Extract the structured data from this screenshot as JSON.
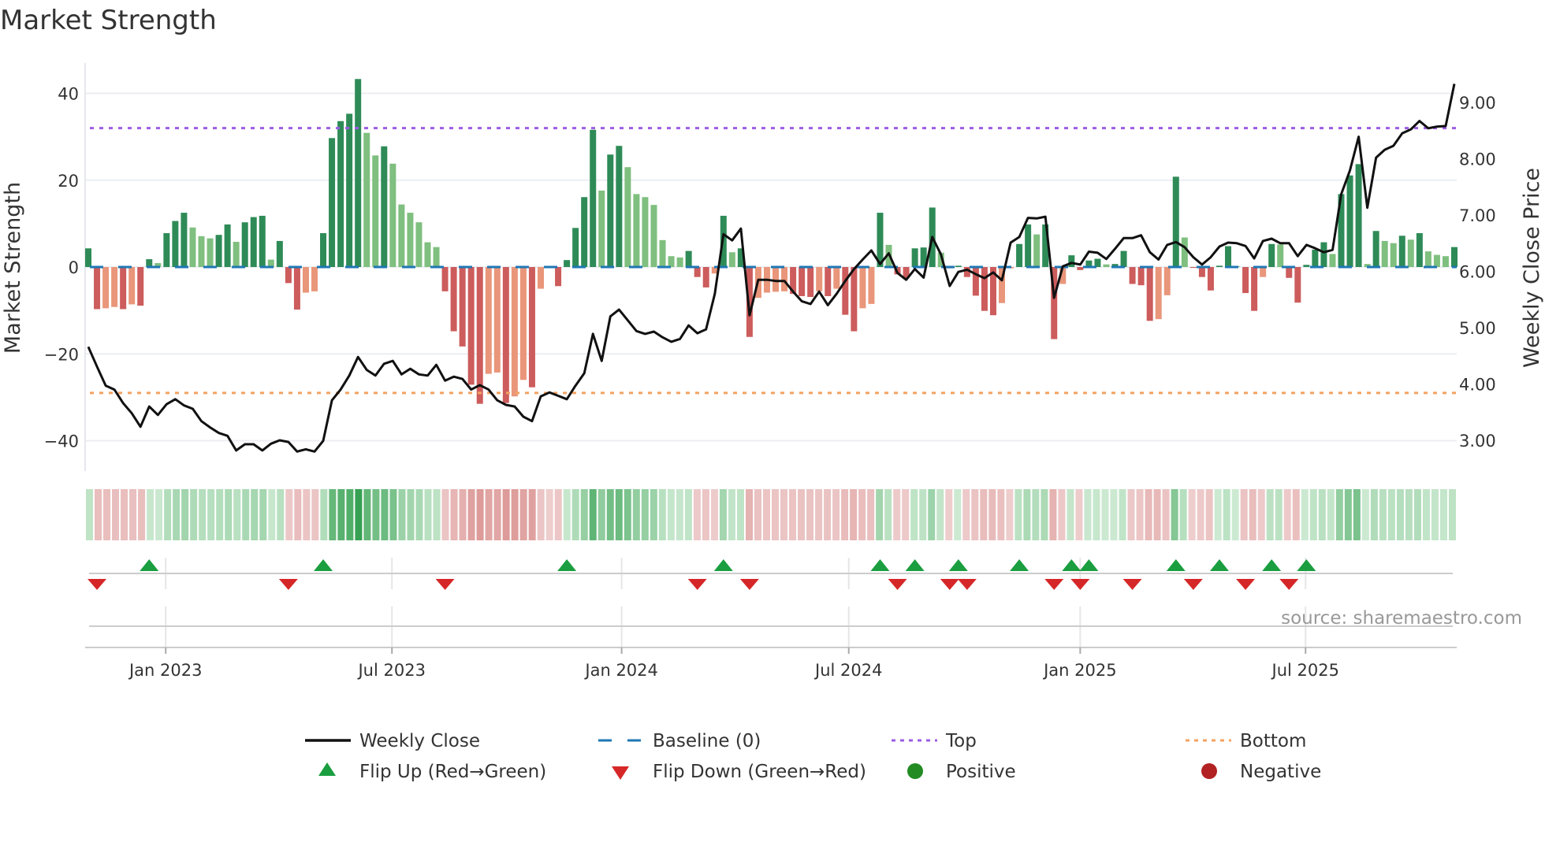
{
  "title": "Market Strength",
  "source": "source: sharemaestro.com",
  "colors": {
    "up_rising": "#2e8b57",
    "up_falling": "#7fbf7f",
    "down_falling": "#cd5c5c",
    "down_rising": "#e9967a",
    "line": "#111111",
    "baseline": "#1f77b4",
    "top": "#9b5de5",
    "bottom": "#f4a261",
    "flip_up": "#1a9e3f",
    "flip_down": "#d62728",
    "positive": "#228b22",
    "negative": "#b22222"
  },
  "legend": [
    {
      "label": "Weekly Close",
      "kind": "line"
    },
    {
      "label": "Baseline (0)",
      "kind": "dash"
    },
    {
      "label": "Top",
      "kind": "dot-top"
    },
    {
      "label": "Bottom",
      "kind": "dot-bottom"
    },
    {
      "label": "Flip Up (Red→Green)",
      "kind": "tri-up"
    },
    {
      "label": "Flip Down (Green→Red)",
      "kind": "tri-down"
    },
    {
      "label": "Positive",
      "kind": "circle-pos"
    },
    {
      "label": "Negative",
      "kind": "circle-neg"
    }
  ],
  "chart_data": {
    "type": "bar",
    "title": "Market Strength",
    "ylabel": "Market Strength",
    "y2label": "Weekly Close Price",
    "ylim": [
      -47,
      47
    ],
    "y2lim": [
      2.45,
      9.68
    ],
    "yticks": [
      {
        "v": 40,
        "label": "40"
      },
      {
        "v": 20,
        "label": "20"
      },
      {
        "v": 0,
        "label": "0"
      },
      {
        "v": -20,
        "label": "−20"
      },
      {
        "v": -40,
        "label": "−40"
      }
    ],
    "y2ticks": [
      {
        "v": 9,
        "label": "9.00"
      },
      {
        "v": 8,
        "label": "8.00"
      },
      {
        "v": 7,
        "label": "7.00"
      },
      {
        "v": 6,
        "label": "6.00"
      },
      {
        "v": 5,
        "label": "5.00"
      },
      {
        "v": 4,
        "label": "4.00"
      },
      {
        "v": 3,
        "label": "3.00"
      }
    ],
    "xticks": [
      {
        "at": 8.9,
        "label": "Jan 2023"
      },
      {
        "at": 34.9,
        "label": "Jul 2023"
      },
      {
        "at": 61.3,
        "label": "Jan 2024"
      },
      {
        "at": 87.4,
        "label": "Jul 2024"
      },
      {
        "at": 114.0,
        "label": "Jan 2025"
      },
      {
        "at": 139.9,
        "label": "Jul 2025"
      }
    ],
    "top_level": 32,
    "bottom_level": -29,
    "baseline": 0,
    "strength": [
      4.3,
      -9.7,
      -9.5,
      -9.2,
      -9.7,
      -8.6,
      -8.9,
      1.8,
      0.9,
      7.8,
      10.6,
      12.5,
      9.1,
      7.1,
      6.6,
      7.4,
      9.8,
      5.8,
      10.3,
      11.5,
      11.8,
      1.7,
      6.0,
      -3.7,
      -9.8,
      -5.9,
      -5.6,
      7.8,
      29.7,
      33.6,
      35.3,
      43.3,
      30.9,
      25.7,
      27.8,
      23.8,
      14.4,
      12.5,
      10.3,
      5.7,
      4.6,
      -5.6,
      -14.8,
      -18.3,
      -27.1,
      -31.5,
      -24.6,
      -24.3,
      -31.3,
      -29.8,
      -26.0,
      -27.7,
      -5.0,
      -0.2,
      -4.4,
      1.6,
      9.0,
      16.1,
      31.6,
      17.6,
      25.9,
      27.9,
      23.0,
      16.8,
      16.1,
      14.3,
      6.2,
      2.5,
      2.2,
      3.7,
      -2.3,
      -4.7,
      -1.5,
      11.8,
      3.4,
      4.3,
      -16.1,
      -7.1,
      -5.9,
      -5.7,
      -5.6,
      -6.2,
      -6.7,
      -6.9,
      -5.6,
      -6.7,
      -5.0,
      -11.0,
      -14.8,
      -9.5,
      -8.5,
      12.5,
      5.1,
      -1.7,
      -2.6,
      4.3,
      4.5,
      13.7,
      3.3,
      -0.3,
      0.3,
      -2.3,
      -6.6,
      -10.1,
      -11.1,
      -8.3,
      -0.3,
      5.3,
      9.8,
      7.5,
      9.8,
      -16.6,
      -3.9,
      2.7,
      -0.7,
      1.5,
      1.9,
      0.6,
      0.7,
      3.7,
      -3.9,
      -4.2,
      -12.4,
      -12.0,
      -6.5,
      20.8,
      6.8,
      -0.2,
      -2.3,
      -5.4,
      0.3,
      4.8,
      0.2,
      -6.0,
      -10.1,
      -2.3,
      5.3,
      5.2,
      -2.5,
      -8.2,
      0.5,
      4.0,
      5.7,
      3.0,
      16.8,
      21.1,
      23.7,
      0.7,
      8.3,
      6.0,
      5.5,
      7.2,
      6.3,
      7.8,
      3.6,
      2.8,
      2.5,
      4.6
    ],
    "weekly_close": [
      4.66,
      4.31,
      3.97,
      3.9,
      3.66,
      3.48,
      3.24,
      3.6,
      3.45,
      3.64,
      3.73,
      3.62,
      3.56,
      3.34,
      3.23,
      3.13,
      3.08,
      2.82,
      2.93,
      2.93,
      2.82,
      2.94,
      3.0,
      2.97,
      2.8,
      2.84,
      2.8,
      2.99,
      3.71,
      3.9,
      4.15,
      4.48,
      4.25,
      4.15,
      4.36,
      4.41,
      4.17,
      4.27,
      4.17,
      4.15,
      4.34,
      4.06,
      4.13,
      4.09,
      3.9,
      3.98,
      3.9,
      3.71,
      3.63,
      3.6,
      3.42,
      3.34,
      3.78,
      3.85,
      3.79,
      3.73,
      3.97,
      4.19,
      4.89,
      4.41,
      5.2,
      5.32,
      5.13,
      4.94,
      4.89,
      4.93,
      4.83,
      4.75,
      4.8,
      5.04,
      4.9,
      4.97,
      5.6,
      6.66,
      6.55,
      6.76,
      5.22,
      5.85,
      5.85,
      5.83,
      5.83,
      5.64,
      5.47,
      5.42,
      5.64,
      5.4,
      5.6,
      5.83,
      6.04,
      6.21,
      6.37,
      6.13,
      6.32,
      5.97,
      5.85,
      6.04,
      5.89,
      6.61,
      6.3,
      5.74,
      5.99,
      6.03,
      5.95,
      5.88,
      5.98,
      5.84,
      6.51,
      6.61,
      6.95,
      6.94,
      6.97,
      5.53,
      6.09,
      6.15,
      6.12,
      6.35,
      6.33,
      6.22,
      6.4,
      6.59,
      6.59,
      6.64,
      6.34,
      6.21,
      6.47,
      6.52,
      6.43,
      6.25,
      6.12,
      6.25,
      6.44,
      6.51,
      6.5,
      6.45,
      6.23,
      6.54,
      6.58,
      6.5,
      6.5,
      6.27,
      6.47,
      6.41,
      6.34,
      6.38,
      7.37,
      7.79,
      8.39,
      7.13,
      8.02,
      8.16,
      8.23,
      8.45,
      8.52,
      8.67,
      8.54,
      8.57,
      8.58,
      9.33
    ],
    "legend_position": "bottom",
    "grid": true
  }
}
